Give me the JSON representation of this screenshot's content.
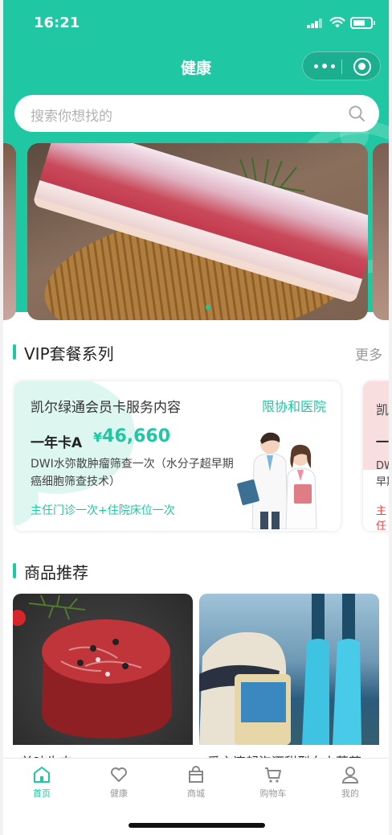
{
  "status_bar": {
    "time": "16:21"
  },
  "nav": {
    "title": "健康"
  },
  "search": {
    "placeholder": "搜索你想找的"
  },
  "banner": {
    "slide_count": 2,
    "active_index": 0
  },
  "vip_section": {
    "title": "VIP套餐系列",
    "more_label": "更多",
    "cards": [
      {
        "name": "凯尔绿通会员卡服务内容",
        "hospital": "限协和医院",
        "type": "一年卡A",
        "currency": "¥",
        "price": "46,660",
        "description": "DWI水弥散肿瘤筛查一次（水分子超早期癌细胞筛查技术）",
        "extra": "主任门诊一次+住院床位一次"
      },
      {
        "name": "凯",
        "type": "一",
        "description": "DWI 早期",
        "extra": "主任"
      }
    ]
  },
  "product_section": {
    "title": "商品推荐",
    "items": [
      {
        "name": "美味牛肉"
      },
      {
        "name": "爱之滴起泡酒甜型白人葡萄"
      }
    ]
  },
  "tabbar": {
    "active": "home",
    "items": [
      {
        "key": "home",
        "label": "首页",
        "icon": "home-icon"
      },
      {
        "key": "health",
        "label": "健康",
        "icon": "heart-icon"
      },
      {
        "key": "mall",
        "label": "商城",
        "icon": "bag-icon"
      },
      {
        "key": "cart",
        "label": "购物车",
        "icon": "cart-icon"
      },
      {
        "key": "mine",
        "label": "我的",
        "icon": "user-icon"
      }
    ]
  },
  "colors": {
    "accent": "#1fc7a3",
    "text": "#333333",
    "muted": "#999999"
  }
}
